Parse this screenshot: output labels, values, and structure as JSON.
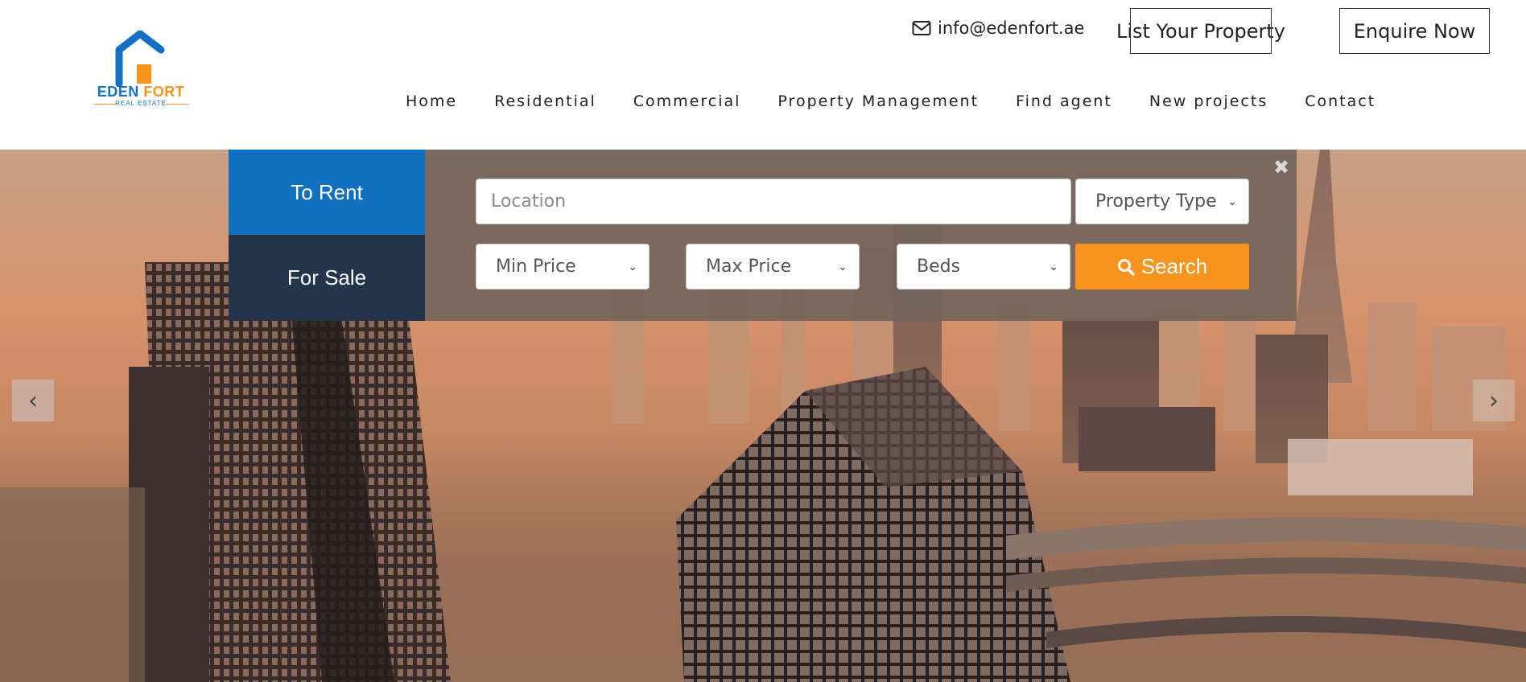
{
  "brand": {
    "name_part1": "EDEN",
    "name_part2": "FORT",
    "tagline": "REAL ESTATE",
    "colors": {
      "blue": "#1470c4",
      "orange": "#f7941d"
    }
  },
  "contact": {
    "email": "info@edenfort.ae",
    "icon": "envelope-icon"
  },
  "header_buttons": {
    "list_property": "List Your Property",
    "enquire": "Enquire Now"
  },
  "nav": {
    "items": [
      {
        "label": "Home"
      },
      {
        "label": "Residential"
      },
      {
        "label": "Commercial"
      },
      {
        "label": "Property Management"
      },
      {
        "label": "Find agent"
      },
      {
        "label": "New projects"
      },
      {
        "label": "Contact"
      }
    ]
  },
  "search": {
    "tabs": [
      {
        "label": "To Rent",
        "active": true
      },
      {
        "label": "For Sale",
        "active": false
      }
    ],
    "location_placeholder": "Location",
    "property_type": "Property Type",
    "min_price": "Min Price",
    "max_price": "Max Price",
    "beds": "Beds",
    "search_label": "Search",
    "close_symbol": "✖",
    "colors": {
      "rent_tab": "#1170c0",
      "sale_tab": "#24354b",
      "search_button": "#f7941d"
    }
  },
  "carousel": {
    "prev_symbol": "‹",
    "next_symbol": "›"
  }
}
